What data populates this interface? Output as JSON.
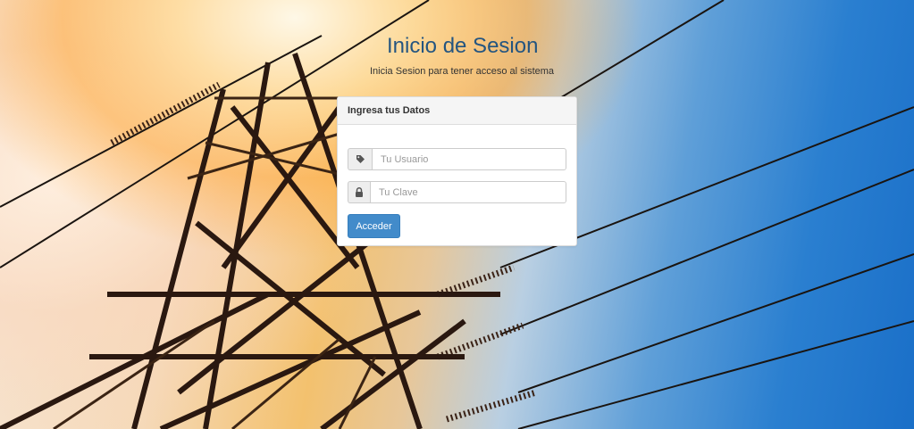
{
  "page": {
    "title": "Inicio de Sesion",
    "subtitle": "Inicia Sesion para tener acceso al sistema"
  },
  "login_panel": {
    "heading": "Ingresa tus Datos",
    "username": {
      "icon": "tag-icon",
      "placeholder": "Tu Usuario",
      "value": ""
    },
    "password": {
      "icon": "lock-icon",
      "placeholder": "Tu Clave",
      "value": ""
    },
    "submit_label": "Acceder"
  },
  "colors": {
    "title": "#245580",
    "primary_button": "#428bca",
    "panel_heading_bg": "#f5f5f5"
  }
}
